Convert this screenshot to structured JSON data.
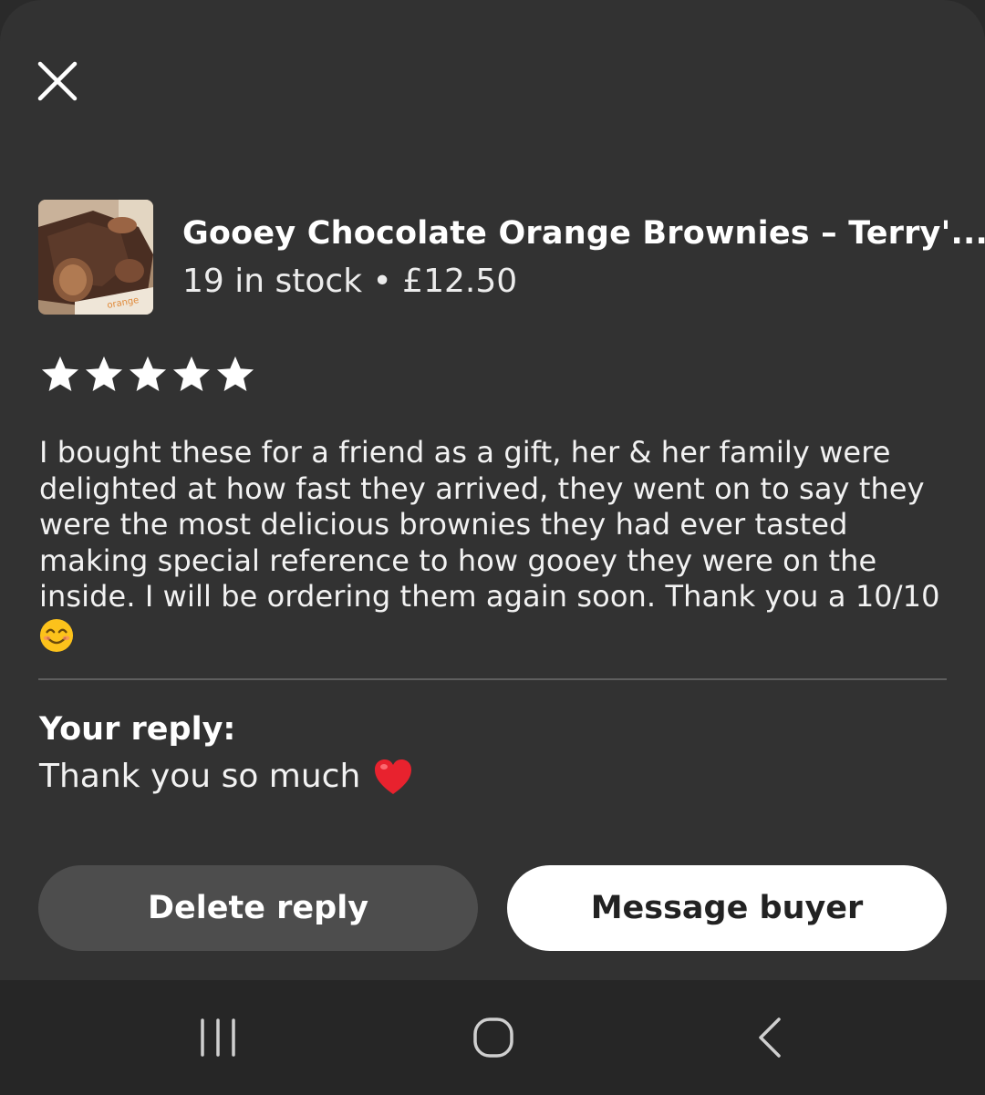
{
  "icons": {
    "close": "close-icon",
    "star": "star-icon",
    "recent": "recent-apps-icon",
    "home": "home-icon",
    "back": "back-icon"
  },
  "product": {
    "title": "Gooey Chocolate Orange Brownies – Terry'...",
    "meta": "19 in stock • £12.50",
    "thumbnail_text": "orange"
  },
  "review": {
    "rating": 5,
    "rating_max": 5,
    "text": "I bought these for a friend as a gift, her & her family were delighted at how fast they arrived, they went on to say they were the most delicious brownies they had ever tasted making special reference to how gooey they were on the inside. I will be ordering them again soon. Thank you a 10/10"
  },
  "reply": {
    "label": "Your reply:",
    "text": "Thank you so much"
  },
  "actions": {
    "delete_label": "Delete reply",
    "message_label": "Message buyer"
  },
  "colors": {
    "sheet_bg": "#323232",
    "nav_bg": "#262626",
    "button_secondary": "#4d4d4d",
    "button_primary": "#ffffff"
  }
}
